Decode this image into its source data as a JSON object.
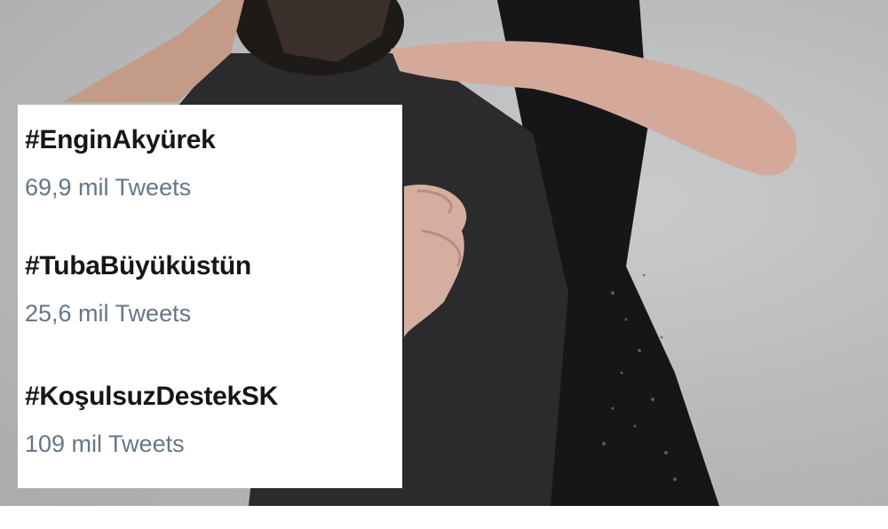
{
  "trends": [
    {
      "tag": "#EnginAkyürek",
      "count": "69,9 mil Tweets"
    },
    {
      "tag": "#TubaBüyüküstün",
      "count": "25,6 mil Tweets"
    },
    {
      "tag": "#KoşulsuzDestekSK",
      "count": "109 mil Tweets"
    }
  ]
}
